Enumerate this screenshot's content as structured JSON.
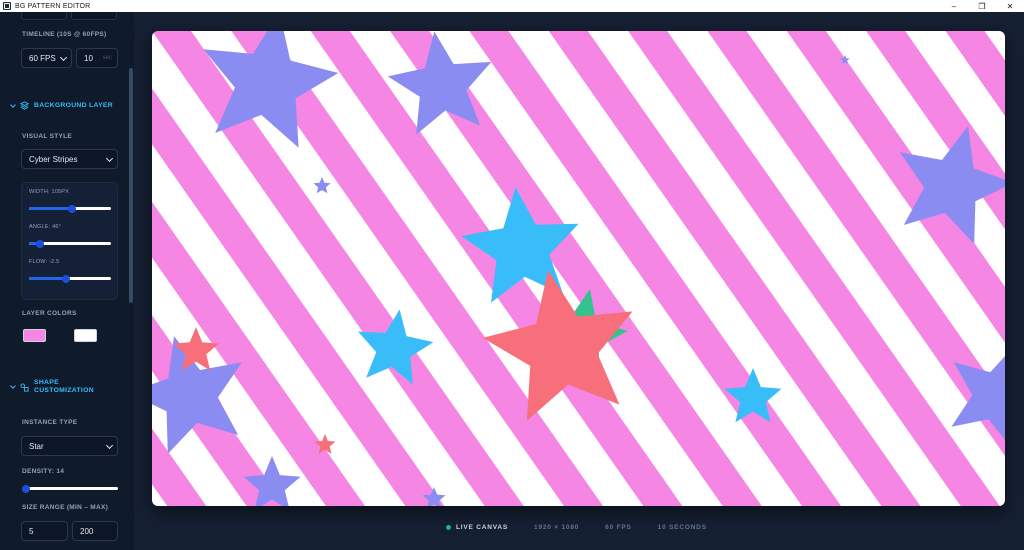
{
  "window": {
    "title": "BG PATTERN EDITOR",
    "controls": [
      "minimize",
      "maximize",
      "close"
    ]
  },
  "sidebar": {
    "timeline": {
      "label": "TIMELINE (10S @ 60FPS)",
      "fps_value": "60 FPS",
      "duration_value": "10",
      "duration_suffix": "sec"
    },
    "background_layer": {
      "title": "BACKGROUND LAYER",
      "visual_style_label": "VISUAL STYLE",
      "visual_style_value": "Cyber Stripes",
      "sliders": [
        {
          "label": "WIDTH: 105PX",
          "fraction": 0.52
        },
        {
          "label": "ANGLE: 46°",
          "fraction": 0.13
        },
        {
          "label": "FLOW: -2.5",
          "fraction": 0.45
        }
      ],
      "colors_label": "LAYER COLORS",
      "colors": [
        "#f686e4",
        "#ffffff"
      ]
    },
    "shape_customization": {
      "title_line1": "SHAPE",
      "title_line2": "CUSTOMIZATION",
      "instance_type_label": "INSTANCE TYPE",
      "instance_type_value": "Star",
      "density_label": "DENSITY: 14",
      "density_fraction": 0.04,
      "size_range_label": "SIZE RANGE (MIN – MAX)",
      "size_min": "5",
      "size_max": "200"
    }
  },
  "canvas": {
    "stripe_colors": [
      "#f686e4",
      "#ffffff"
    ],
    "star_colors": {
      "violet": "#8b8cf1",
      "sky": "#38bdf8",
      "coral": "#f76f7a",
      "emerald": "#34c38f"
    }
  },
  "status": {
    "live": "LIVE CANVAS",
    "resolution": "1920 × 1080",
    "fps": "60 FPS",
    "duration": "10 SECONDS",
    "live_color": "#10b981"
  }
}
